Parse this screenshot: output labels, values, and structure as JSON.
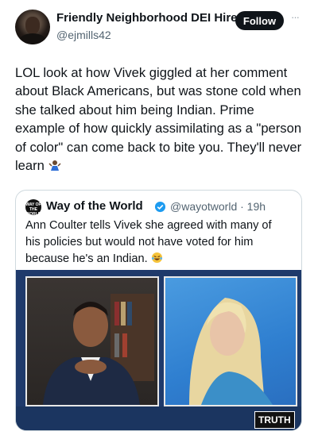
{
  "author": {
    "name": "Friendly Neighborhood DEI Hire",
    "handle": "@ejmills42",
    "follow_label": "Follow",
    "more_label": "···"
  },
  "tweet": {
    "text": "LOL look at how Vivek giggled at her comment about Black Americans, but was stone cold when she talked about him being Indian. Prime example of how quickly assimilating as a \"person of color\" can come back to bite you. They'll never learn",
    "emoji": "person-shrugging-emoji"
  },
  "quote": {
    "avatar_text": "WAY OF THE WORLD",
    "name": "Way of the World",
    "handle_time": "@wayotworld · 19h",
    "text": "Ann Coulter tells Vivek she agreed with many of his policies but would not have voted for him because he's an Indian.",
    "emoji": "laughing-tears-emoji",
    "media": {
      "watermark": "TRUTH"
    }
  },
  "colors": {
    "verified": "#1d9bf0",
    "follow_bg": "#0f1419",
    "media_bg": "#1f3a6b"
  }
}
